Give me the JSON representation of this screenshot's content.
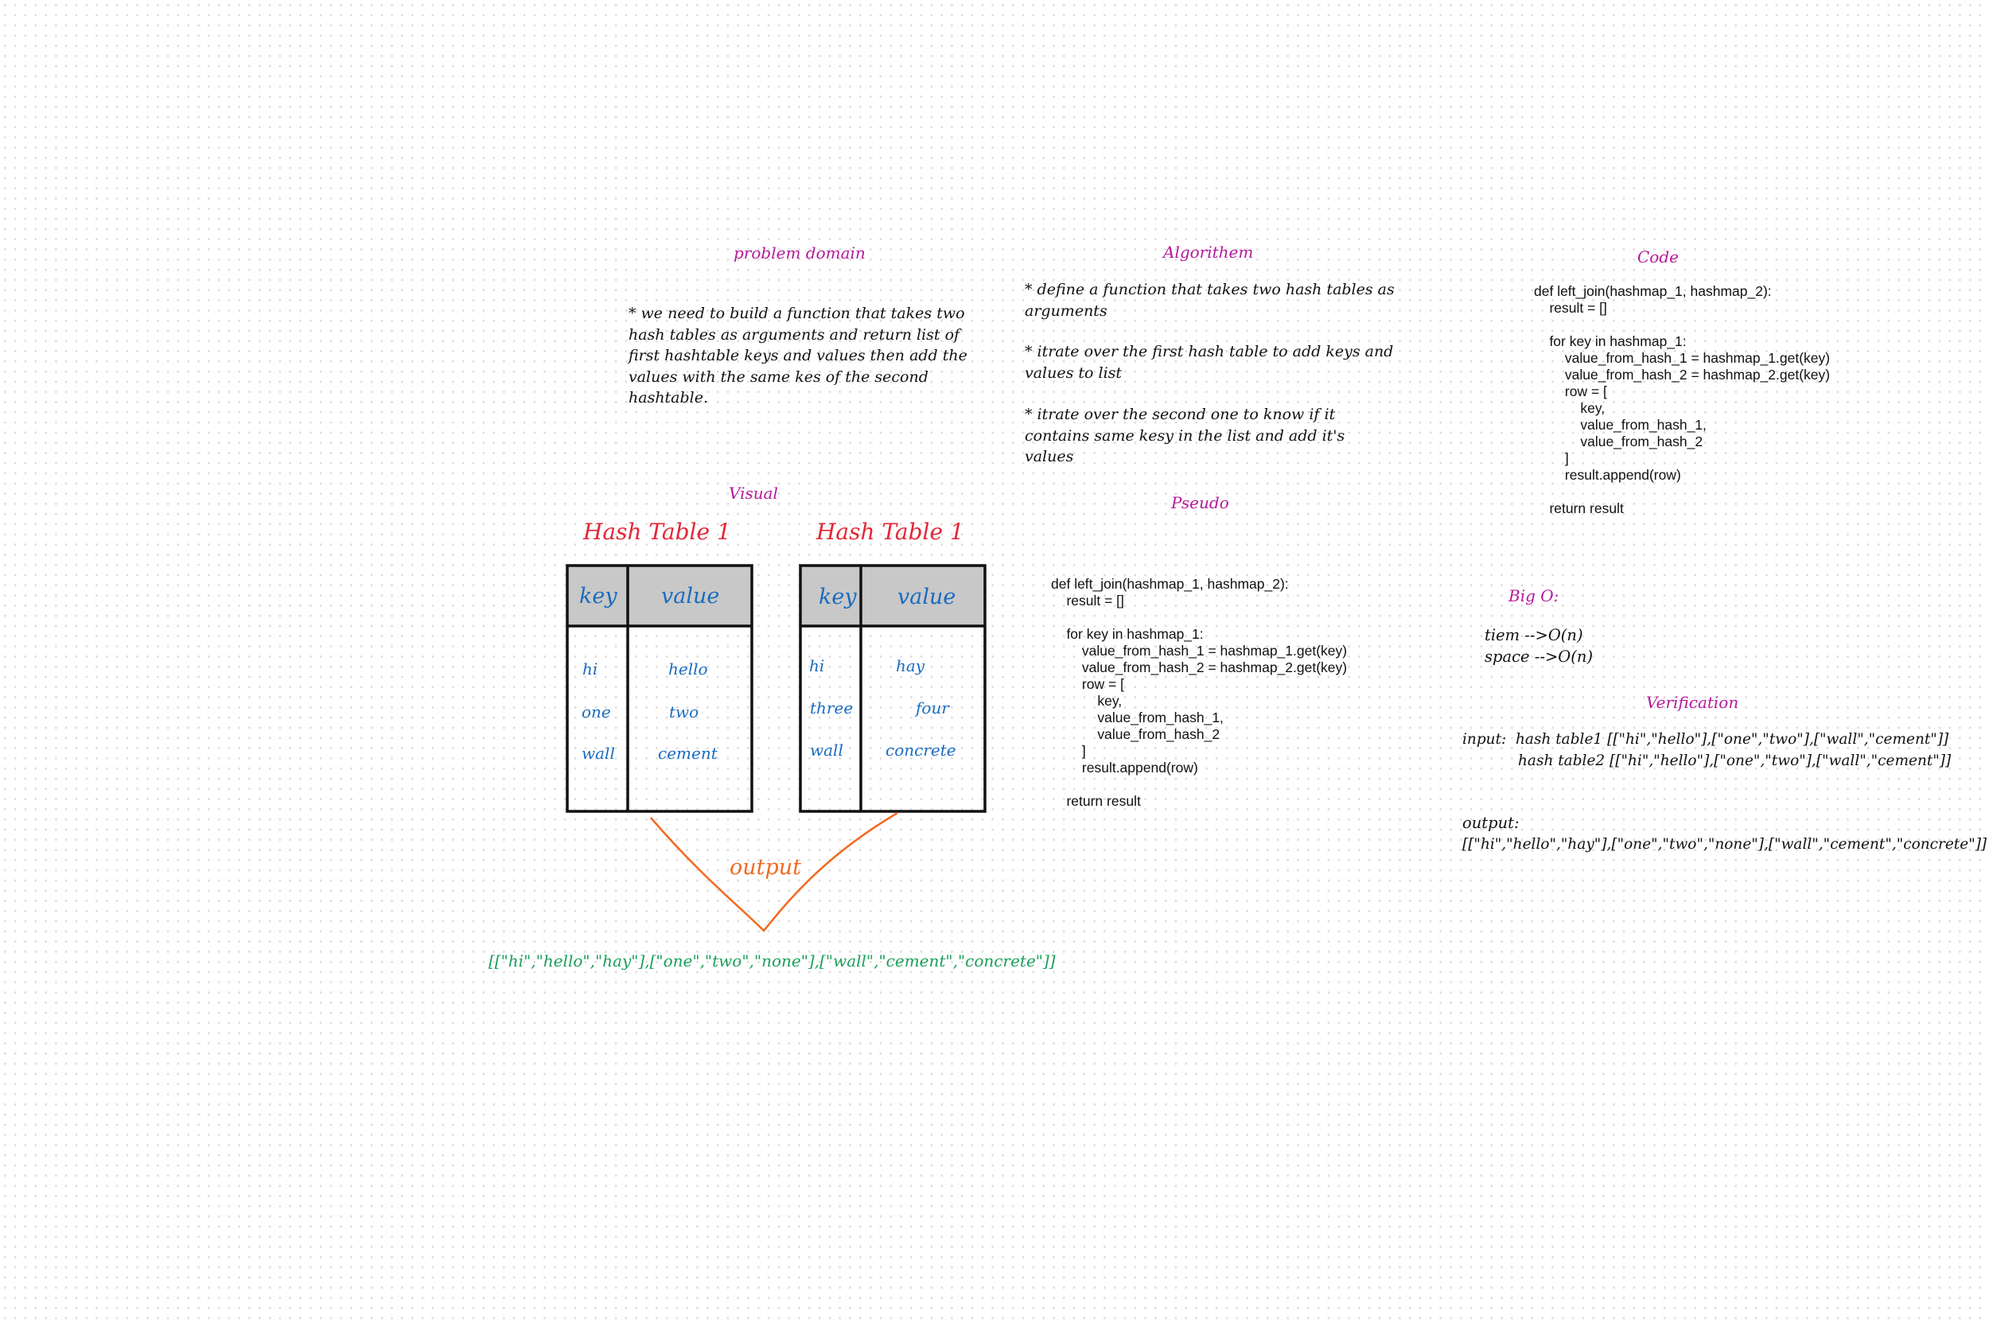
{
  "problem": {
    "heading": "problem  domain",
    "text": "* we need to build a function that takes two hash tables as arguments and return list of first hashtable keys and values then add the values with the same kes of the second hashtable."
  },
  "algorithm": {
    "heading": "Algorithem",
    "steps": [
      "* define a function that takes two hash tables as arguments",
      "* itrate over the first hash table to add keys and values to list",
      "* itrate over the second one to know if it contains same kesy  in the list and add it's values"
    ]
  },
  "code_section": {
    "heading": "Code",
    "code": "def left_join(hashmap_1, hashmap_2):\n    result = []\n\n    for key in hashmap_1:\n        value_from_hash_1 = hashmap_1.get(key)\n        value_from_hash_2 = hashmap_2.get(key)\n        row = [\n            key,\n            value_from_hash_1,\n            value_from_hash_2\n        ]\n        result.append(row)\n\n    return result"
  },
  "visual": {
    "heading": "Visual",
    "tables": [
      {
        "title": "Hash Table 1",
        "key_header": "key",
        "value_header": "value",
        "rows": [
          {
            "key": "hi",
            "value": "hello"
          },
          {
            "key": "one",
            "value": "two"
          },
          {
            "key": "wall",
            "value": "cement"
          }
        ]
      },
      {
        "title": "Hash Table 1",
        "key_header": "key",
        "value_header": "value",
        "rows": [
          {
            "key": "hi",
            "value": "hay"
          },
          {
            "key": "three",
            "value": "four"
          },
          {
            "key": "wall",
            "value": "concrete"
          }
        ]
      }
    ],
    "output_label": "output",
    "output_value": "[[\"hi\",\"hello\",\"hay\"],[\"one\",\"two\",\"none\"],[\"wall\",\"cement\",\"concrete\"]]"
  },
  "pseudo": {
    "heading": "Pseudo",
    "code": "def left_join(hashmap_1, hashmap_2):\n    result = []\n\n    for key in hashmap_1:\n        value_from_hash_1 = hashmap_1.get(key)\n        value_from_hash_2 = hashmap_2.get(key)\n        row = [\n            key,\n            value_from_hash_1,\n            value_from_hash_2\n        ]\n        result.append(row)\n\n    return result"
  },
  "big_o": {
    "heading": "Big O:",
    "time": "tiem -->O(n)",
    "space": "space -->O(n)"
  },
  "verification": {
    "heading": "Verification",
    "input_line1": "input:  hash table1 [[\"hi\",\"hello\"],[\"one\",\"two\"],[\"wall\",\"cement\"]]",
    "input_line2": "hash table2 [[\"hi\",\"hello\"],[\"one\",\"two\"],[\"wall\",\"cement\"]]",
    "output_label": "output:",
    "output_value": "[[\"hi\",\"hello\",\"hay\"],[\"one\",\"two\",\"none\"],[\"wall\",\"cement\",\"concrete\"]]"
  },
  "colors": {
    "heading": "#b5199c",
    "table_title": "#e32636",
    "table_text": "#1a6bbf",
    "table_header_bg": "#c8c8c8",
    "output_arrow": "#f26a21",
    "output_value": "#19a05a"
  }
}
